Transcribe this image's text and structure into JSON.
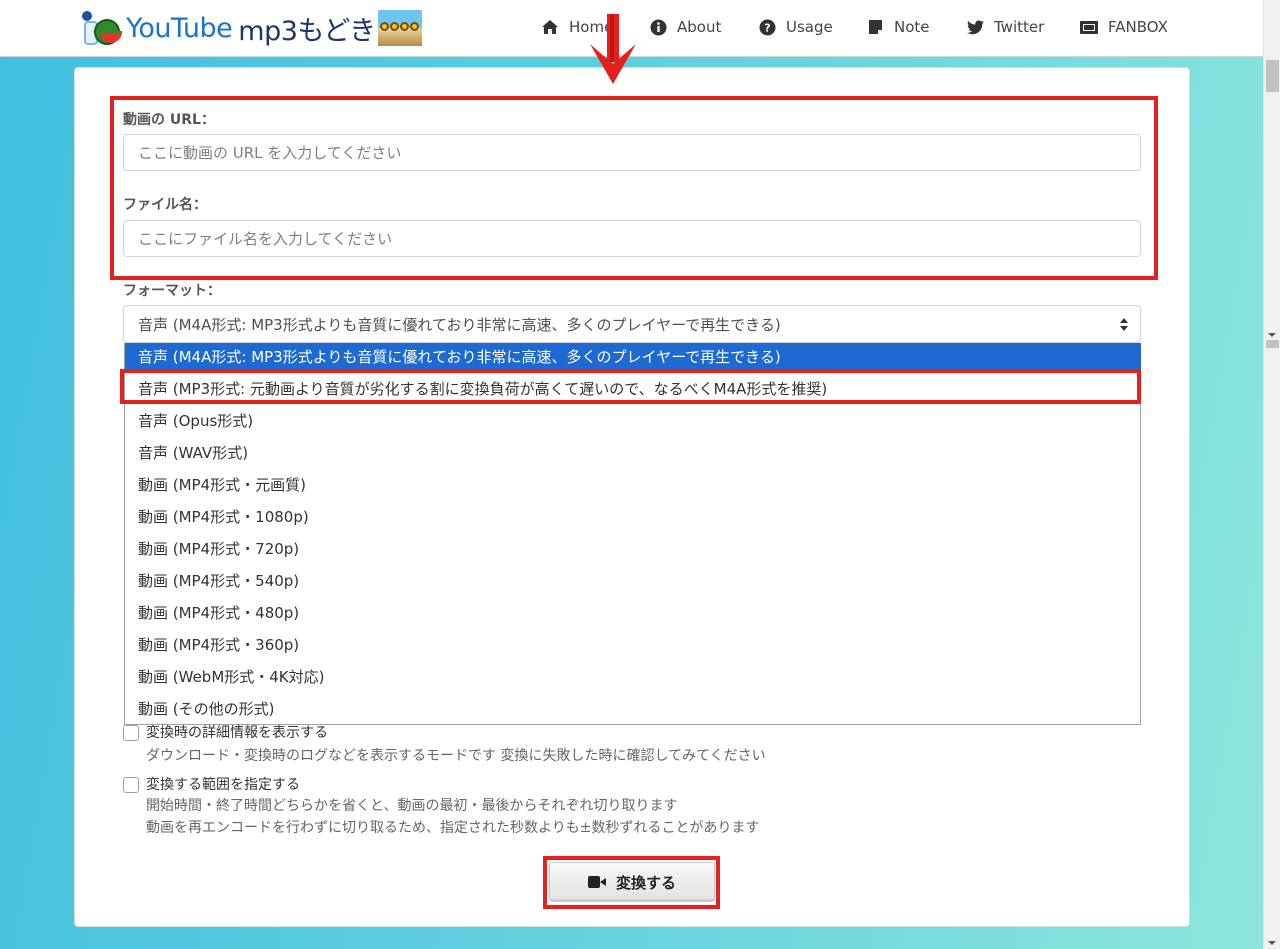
{
  "header": {
    "logo": {
      "text_youtube": "YouTube",
      "text_mp3": "mp3もどき"
    },
    "nav": [
      {
        "label": "Home",
        "icon": "home-icon"
      },
      {
        "label": "About",
        "icon": "info-circle-icon"
      },
      {
        "label": "Usage",
        "icon": "question-circle-icon"
      },
      {
        "label": "Note",
        "icon": "sticky-note-icon"
      },
      {
        "label": "Twitter",
        "icon": "twitter-icon"
      },
      {
        "label": "FANBOX",
        "icon": "fanbox-icon"
      }
    ]
  },
  "form": {
    "url_label": "動画の URL：",
    "url_placeholder": "ここに動画の URL を入力してください",
    "url_value": "",
    "filename_label": "ファイル名：",
    "filename_placeholder": "ここにファイル名を入力してください",
    "filename_value": "",
    "format_label": "フォーマット：",
    "format_selected": "音声 (M4A形式: MP3形式よりも音質に優れており非常に高速、多くのプレイヤーで再生できる)",
    "format_options": [
      "音声 (M4A形式: MP3形式よりも音質に優れており非常に高速、多くのプレイヤーで再生できる)",
      "音声 (MP3形式: 元動画より音質が劣化する割に変換負荷が高くて遅いので、なるべくM4A形式を推奨)",
      "音声 (Opus形式)",
      "音声 (WAV形式)",
      "動画 (MP4形式・元画質)",
      "動画 (MP4形式・1080p)",
      "動画 (MP4形式・720p)",
      "動画 (MP4形式・540p)",
      "動画 (MP4形式・480p)",
      "動画 (MP4形式・360p)",
      "動画 (WebM形式・4K対応)",
      "動画 (その他の形式)"
    ],
    "verbose": {
      "title": "変換時の詳細情報を表示する",
      "desc": "ダウンロード・変換時のログなどを表示するモードです 変換に失敗した時に確認してみてください",
      "checked": false
    },
    "range": {
      "title": "変換する範囲を指定する",
      "desc1": "開始時間・終了時間どちらかを省くと、動画の最初・最後からそれぞれ切り取ります",
      "desc2": "動画を再エンコードを行わずに切り取るため、指定された秒数よりも±数秒ずれることがあります",
      "checked": false
    },
    "convert_label": "変換する"
  },
  "colors": {
    "annotation": "#e5211d",
    "selected_option": "#1e6ad2",
    "logo_blue": "#1b73d1",
    "logo_navy": "#1f3470"
  }
}
